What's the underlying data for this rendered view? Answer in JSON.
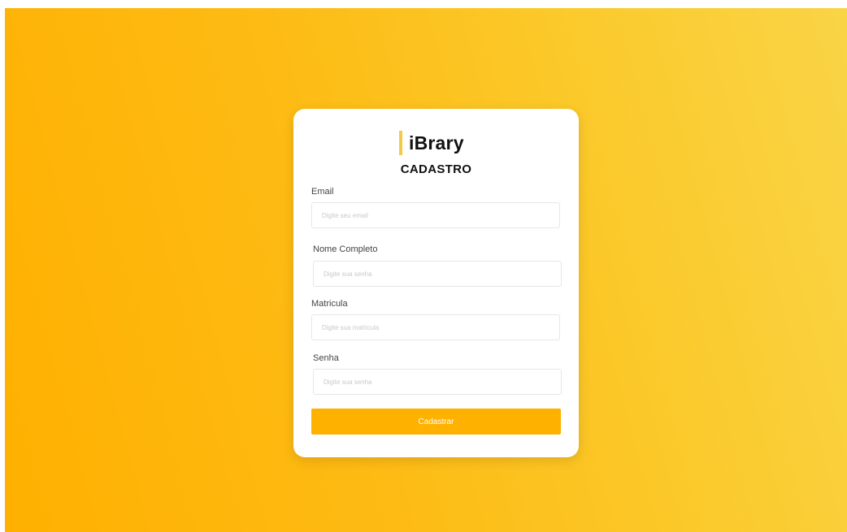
{
  "colors": {
    "accent": "#ffb100",
    "brand_bar": "#f6c945",
    "background_start": "#ffb000",
    "background_end": "#f9d446"
  },
  "brand": {
    "name": "iBrary"
  },
  "form": {
    "title": "CADASTRO",
    "fields": [
      {
        "label": "Email",
        "placeholder": "Digite seu email",
        "value": ""
      },
      {
        "label": "Nome Completo",
        "placeholder": "Digite sua senha",
        "value": ""
      },
      {
        "label": "Matricula",
        "placeholder": "Digite sua matricula",
        "value": ""
      },
      {
        "label": "Senha",
        "placeholder": "Digite sua senha",
        "value": ""
      }
    ],
    "submit_label": "Cadastrar"
  }
}
